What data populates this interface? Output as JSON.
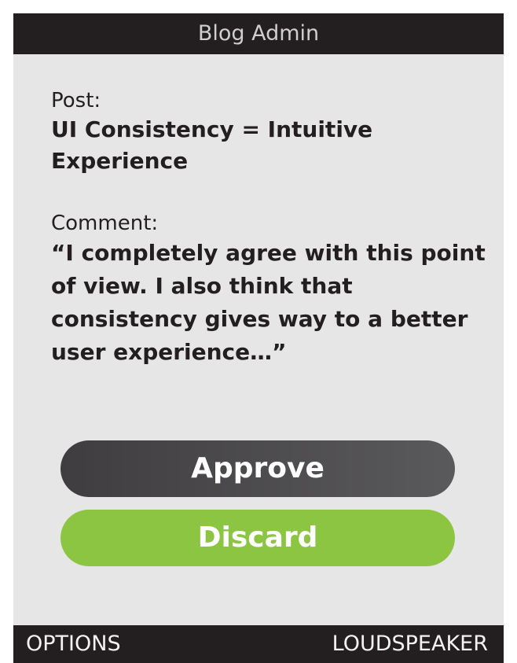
{
  "app": {
    "title": "Blog Admin"
  },
  "post": {
    "label": "Post:",
    "title": "UI Consistency = Intuitive Experience"
  },
  "comment": {
    "label": "Comment:",
    "text": "“I completely agree with this point of view. I also think that consistency gives way to a better user experience…”"
  },
  "actions": {
    "approve_label": "Approve",
    "discard_label": "Discard"
  },
  "softkeys": {
    "left": "OPTIONS",
    "right": "LOUDSPEAKER"
  },
  "colors": {
    "title_bar": "#231f20",
    "background": "#e6e6e6",
    "approve_button": "#4a494c",
    "discard_button": "#8bc541",
    "text": "#231f20"
  }
}
